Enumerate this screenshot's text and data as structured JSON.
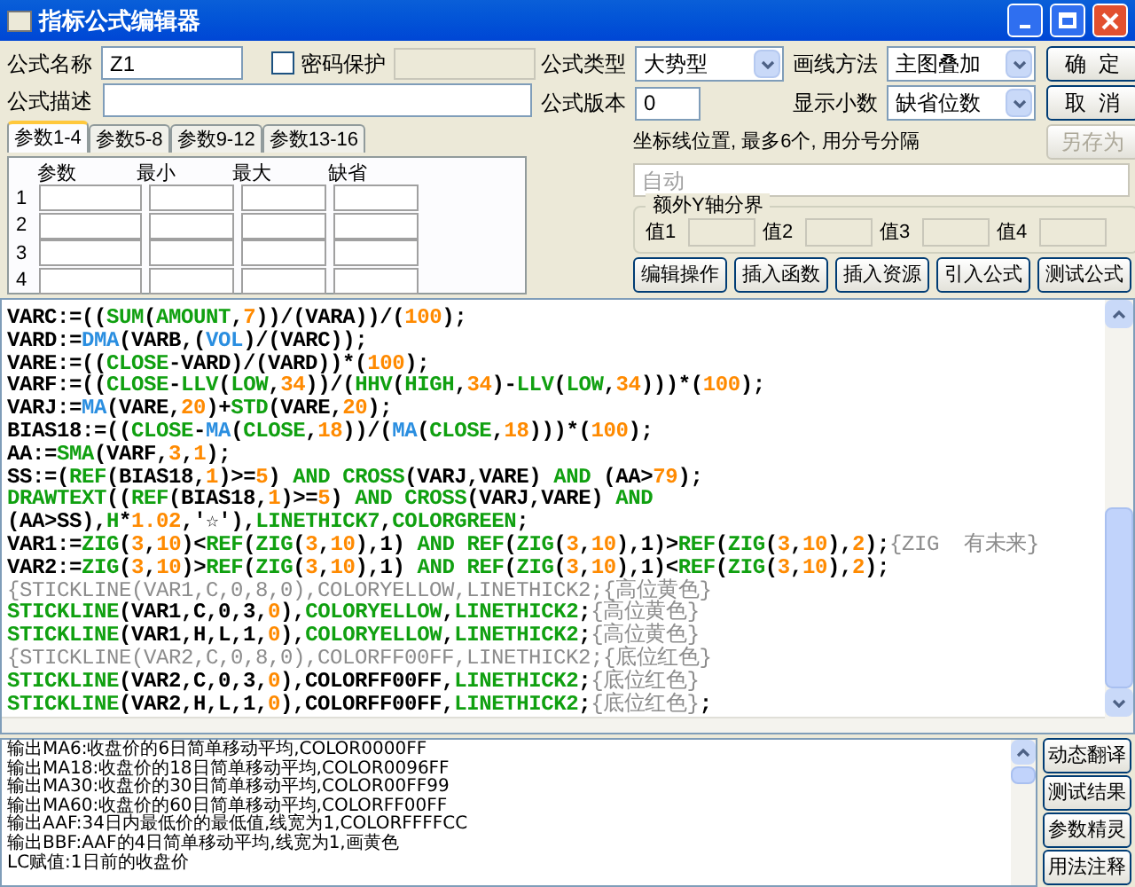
{
  "window": {
    "title": "指标公式编辑器"
  },
  "form": {
    "name_label": "公式名称",
    "name_value": "Z1",
    "password": {
      "label": "密码保护",
      "checked": false
    },
    "desc_label": "公式描述",
    "type_label": "公式类型",
    "type_value": "大势型",
    "version_label": "公式版本",
    "version_value": "0",
    "draw_label": "画线方法",
    "draw_value": "主图叠加",
    "decimals_label": "显示小数",
    "decimals_value": "缺省位数",
    "side_buttons": [
      {
        "label": "确  定",
        "disabled": false
      },
      {
        "label": "取  消",
        "disabled": false
      },
      {
        "label": "另存为",
        "disabled": true
      }
    ],
    "axis_label": "坐标线位置, 最多6个, 用分号分隔",
    "axis_placeholder": "自动",
    "extra_group": {
      "title": "额外Y轴分界",
      "values": [
        "值1",
        "值2",
        "值3",
        "值4"
      ]
    },
    "action_buttons": [
      "编辑操作",
      "插入函数",
      "插入资源",
      "引入公式",
      "测试公式"
    ]
  },
  "tabs": [
    {
      "label": "参数1-4",
      "selected": true
    },
    {
      "label": "参数5-8",
      "selected": false
    },
    {
      "label": "参数9-12",
      "selected": false
    },
    {
      "label": "参数13-16",
      "selected": false
    }
  ],
  "params": {
    "headers": [
      "参数",
      "最小",
      "最大",
      "缺省"
    ],
    "rows": [
      "1",
      "2",
      "3",
      "4"
    ]
  },
  "code": {
    "lines": [
      {
        "tokens": [
          {
            "kind": "tx",
            "text": "VARC:=(("
          },
          {
            "kind": "kw",
            "text": "SUM"
          },
          {
            "kind": "tx",
            "text": "("
          },
          {
            "kind": "kw",
            "text": "AMOUNT"
          },
          {
            "kind": "tx",
            "text": ","
          },
          {
            "kind": "num",
            "text": "7"
          },
          {
            "kind": "tx",
            "text": "))/(VARA))/("
          },
          {
            "kind": "num",
            "text": "100"
          },
          {
            "kind": "tx",
            "text": ");"
          }
        ]
      },
      {
        "tokens": [
          {
            "kind": "tx",
            "text": "VARD:="
          },
          {
            "kind": "fn",
            "text": "DMA"
          },
          {
            "kind": "tx",
            "text": "(VARB,("
          },
          {
            "kind": "fn",
            "text": "VOL"
          },
          {
            "kind": "tx",
            "text": ")/(VARC));"
          }
        ]
      },
      {
        "tokens": [
          {
            "kind": "tx",
            "text": "VARE:=(("
          },
          {
            "kind": "kw",
            "text": "CLOSE"
          },
          {
            "kind": "tx",
            "text": "-VARD)/(VARD))*("
          },
          {
            "kind": "num",
            "text": "100"
          },
          {
            "kind": "tx",
            "text": ");"
          }
        ]
      },
      {
        "tokens": [
          {
            "kind": "tx",
            "text": "VARF:=(("
          },
          {
            "kind": "kw",
            "text": "CLOSE"
          },
          {
            "kind": "tx",
            "text": "-"
          },
          {
            "kind": "kw",
            "text": "LLV"
          },
          {
            "kind": "tx",
            "text": "("
          },
          {
            "kind": "kw",
            "text": "LOW"
          },
          {
            "kind": "tx",
            "text": ","
          },
          {
            "kind": "num",
            "text": "34"
          },
          {
            "kind": "tx",
            "text": "))/("
          },
          {
            "kind": "kw",
            "text": "HHV"
          },
          {
            "kind": "tx",
            "text": "("
          },
          {
            "kind": "kw",
            "text": "HIGH"
          },
          {
            "kind": "tx",
            "text": ","
          },
          {
            "kind": "num",
            "text": "34"
          },
          {
            "kind": "tx",
            "text": ")-"
          },
          {
            "kind": "kw",
            "text": "LLV"
          },
          {
            "kind": "tx",
            "text": "("
          },
          {
            "kind": "kw",
            "text": "LOW"
          },
          {
            "kind": "tx",
            "text": ","
          },
          {
            "kind": "num",
            "text": "34"
          },
          {
            "kind": "tx",
            "text": ")))*("
          },
          {
            "kind": "num",
            "text": "100"
          },
          {
            "kind": "tx",
            "text": ");"
          }
        ]
      },
      {
        "tokens": [
          {
            "kind": "tx",
            "text": "VARJ:="
          },
          {
            "kind": "fn",
            "text": "MA"
          },
          {
            "kind": "tx",
            "text": "(VARE,"
          },
          {
            "kind": "num",
            "text": "20"
          },
          {
            "kind": "tx",
            "text": ")+"
          },
          {
            "kind": "kw",
            "text": "STD"
          },
          {
            "kind": "tx",
            "text": "(VARE,"
          },
          {
            "kind": "num",
            "text": "20"
          },
          {
            "kind": "tx",
            "text": ");"
          }
        ]
      },
      {
        "tokens": [
          {
            "kind": "tx",
            "text": "BIAS18:=(("
          },
          {
            "kind": "kw",
            "text": "CLOSE"
          },
          {
            "kind": "tx",
            "text": "-"
          },
          {
            "kind": "fn",
            "text": "MA"
          },
          {
            "kind": "tx",
            "text": "("
          },
          {
            "kind": "kw",
            "text": "CLOSE"
          },
          {
            "kind": "tx",
            "text": ","
          },
          {
            "kind": "num",
            "text": "18"
          },
          {
            "kind": "tx",
            "text": "))/("
          },
          {
            "kind": "fn",
            "text": "MA"
          },
          {
            "kind": "tx",
            "text": "("
          },
          {
            "kind": "kw",
            "text": "CLOSE"
          },
          {
            "kind": "tx",
            "text": ","
          },
          {
            "kind": "num",
            "text": "18"
          },
          {
            "kind": "tx",
            "text": ")))*("
          },
          {
            "kind": "num",
            "text": "100"
          },
          {
            "kind": "tx",
            "text": ");"
          }
        ]
      },
      {
        "tokens": [
          {
            "kind": "tx",
            "text": "AA:="
          },
          {
            "kind": "kw",
            "text": "SMA"
          },
          {
            "kind": "tx",
            "text": "(VARF,"
          },
          {
            "kind": "num",
            "text": "3"
          },
          {
            "kind": "tx",
            "text": ","
          },
          {
            "kind": "num",
            "text": "1"
          },
          {
            "kind": "tx",
            "text": ");"
          }
        ]
      },
      {
        "tokens": [
          {
            "kind": "tx",
            "text": "SS:=("
          },
          {
            "kind": "kw",
            "text": "REF"
          },
          {
            "kind": "tx",
            "text": "(BIAS18,"
          },
          {
            "kind": "num",
            "text": "1"
          },
          {
            "kind": "tx",
            "text": ")>="
          },
          {
            "kind": "num",
            "text": "5"
          },
          {
            "kind": "tx",
            "text": ") "
          },
          {
            "kind": "kw",
            "text": "AND CROSS"
          },
          {
            "kind": "tx",
            "text": "(VARJ,VARE) "
          },
          {
            "kind": "kw",
            "text": "AND"
          },
          {
            "kind": "tx",
            "text": " (AA>"
          },
          {
            "kind": "num",
            "text": "79"
          },
          {
            "kind": "tx",
            "text": ");"
          }
        ]
      },
      {
        "tokens": [
          {
            "kind": "kw",
            "text": "DRAWTEXT"
          },
          {
            "kind": "tx",
            "text": "(("
          },
          {
            "kind": "kw",
            "text": "REF"
          },
          {
            "kind": "tx",
            "text": "(BIAS18,"
          },
          {
            "kind": "num",
            "text": "1"
          },
          {
            "kind": "tx",
            "text": ")>="
          },
          {
            "kind": "num",
            "text": "5"
          },
          {
            "kind": "tx",
            "text": ") "
          },
          {
            "kind": "kw",
            "text": "AND CROSS"
          },
          {
            "kind": "tx",
            "text": "(VARJ,VARE) "
          },
          {
            "kind": "kw",
            "text": "AND"
          }
        ]
      },
      {
        "tokens": [
          {
            "kind": "tx",
            "text": "(AA>SS),"
          },
          {
            "kind": "kw",
            "text": "H"
          },
          {
            "kind": "tx",
            "text": "*"
          },
          {
            "kind": "num",
            "text": "1.02"
          },
          {
            "kind": "tx",
            "text": ",'☆'),"
          },
          {
            "kind": "kw",
            "text": "LINETHICK7"
          },
          {
            "kind": "tx",
            "text": ","
          },
          {
            "kind": "kw",
            "text": "COLORGREEN"
          },
          {
            "kind": "tx",
            "text": ";"
          }
        ]
      },
      {
        "tokens": [
          {
            "kind": "tx",
            "text": "VAR1:="
          },
          {
            "kind": "kw",
            "text": "ZIG"
          },
          {
            "kind": "tx",
            "text": "("
          },
          {
            "kind": "num",
            "text": "3"
          },
          {
            "kind": "tx",
            "text": ","
          },
          {
            "kind": "num",
            "text": "10"
          },
          {
            "kind": "tx",
            "text": ")<"
          },
          {
            "kind": "kw",
            "text": "REF"
          },
          {
            "kind": "tx",
            "text": "("
          },
          {
            "kind": "kw",
            "text": "ZIG"
          },
          {
            "kind": "tx",
            "text": "("
          },
          {
            "kind": "num",
            "text": "3"
          },
          {
            "kind": "tx",
            "text": ","
          },
          {
            "kind": "num",
            "text": "10"
          },
          {
            "kind": "tx",
            "text": "),1) "
          },
          {
            "kind": "kw",
            "text": "AND REF"
          },
          {
            "kind": "tx",
            "text": "("
          },
          {
            "kind": "kw",
            "text": "ZIG"
          },
          {
            "kind": "tx",
            "text": "("
          },
          {
            "kind": "num",
            "text": "3"
          },
          {
            "kind": "tx",
            "text": ","
          },
          {
            "kind": "num",
            "text": "10"
          },
          {
            "kind": "tx",
            "text": "),1)>"
          },
          {
            "kind": "kw",
            "text": "REF"
          },
          {
            "kind": "tx",
            "text": "("
          },
          {
            "kind": "kw",
            "text": "ZIG"
          },
          {
            "kind": "tx",
            "text": "("
          },
          {
            "kind": "num",
            "text": "3"
          },
          {
            "kind": "tx",
            "text": ","
          },
          {
            "kind": "num",
            "text": "10"
          },
          {
            "kind": "tx",
            "text": "),"
          },
          {
            "kind": "num",
            "text": "2"
          },
          {
            "kind": "tx",
            "text": ");"
          },
          {
            "kind": "cm",
            "text": "{ZIG  有未来}"
          }
        ]
      },
      {
        "tokens": [
          {
            "kind": "tx",
            "text": "VAR2:="
          },
          {
            "kind": "kw",
            "text": "ZIG"
          },
          {
            "kind": "tx",
            "text": "("
          },
          {
            "kind": "num",
            "text": "3"
          },
          {
            "kind": "tx",
            "text": ","
          },
          {
            "kind": "num",
            "text": "10"
          },
          {
            "kind": "tx",
            "text": ")>"
          },
          {
            "kind": "kw",
            "text": "REF"
          },
          {
            "kind": "tx",
            "text": "("
          },
          {
            "kind": "kw",
            "text": "ZIG"
          },
          {
            "kind": "tx",
            "text": "("
          },
          {
            "kind": "num",
            "text": "3"
          },
          {
            "kind": "tx",
            "text": ","
          },
          {
            "kind": "num",
            "text": "10"
          },
          {
            "kind": "tx",
            "text": "),1) "
          },
          {
            "kind": "kw",
            "text": "AND REF"
          },
          {
            "kind": "tx",
            "text": "("
          },
          {
            "kind": "kw",
            "text": "ZIG"
          },
          {
            "kind": "tx",
            "text": "("
          },
          {
            "kind": "num",
            "text": "3"
          },
          {
            "kind": "tx",
            "text": ","
          },
          {
            "kind": "num",
            "text": "10"
          },
          {
            "kind": "tx",
            "text": "),1)<"
          },
          {
            "kind": "kw",
            "text": "REF"
          },
          {
            "kind": "tx",
            "text": "("
          },
          {
            "kind": "kw",
            "text": "ZIG"
          },
          {
            "kind": "tx",
            "text": "("
          },
          {
            "kind": "num",
            "text": "3"
          },
          {
            "kind": "tx",
            "text": ","
          },
          {
            "kind": "num",
            "text": "10"
          },
          {
            "kind": "tx",
            "text": "),"
          },
          {
            "kind": "num",
            "text": "2"
          },
          {
            "kind": "tx",
            "text": ");"
          }
        ]
      },
      {
        "tokens": [
          {
            "kind": "cm",
            "text": "{STICKLINE(VAR1,C,0,8,0),COLORYELLOW,LINETHICK2;{高位黄色}"
          }
        ]
      },
      {
        "tokens": [
          {
            "kind": "kw",
            "text": "STICKLINE"
          },
          {
            "kind": "tx",
            "text": "(VAR1,C,0,3,"
          },
          {
            "kind": "num",
            "text": "0"
          },
          {
            "kind": "tx",
            "text": "),"
          },
          {
            "kind": "kw",
            "text": "COLORYELLOW"
          },
          {
            "kind": "tx",
            "text": ","
          },
          {
            "kind": "kw",
            "text": "LINETHICK2"
          },
          {
            "kind": "tx",
            "text": ";"
          },
          {
            "kind": "cm",
            "text": "{高位黄色}"
          }
        ]
      },
      {
        "tokens": [
          {
            "kind": "kw",
            "text": "STICKLINE"
          },
          {
            "kind": "tx",
            "text": "(VAR1,H,L,1,"
          },
          {
            "kind": "num",
            "text": "0"
          },
          {
            "kind": "tx",
            "text": "),"
          },
          {
            "kind": "kw",
            "text": "COLORYELLOW"
          },
          {
            "kind": "tx",
            "text": ","
          },
          {
            "kind": "kw",
            "text": "LINETHICK2"
          },
          {
            "kind": "tx",
            "text": ";"
          },
          {
            "kind": "cm",
            "text": "{高位黄色}"
          }
        ]
      },
      {
        "tokens": [
          {
            "kind": "cm",
            "text": "{STICKLINE(VAR2,C,0,8,0),COLORFF00FF,LINETHICK2;{底位红色}"
          }
        ]
      },
      {
        "tokens": [
          {
            "kind": "kw",
            "text": "STICKLINE"
          },
          {
            "kind": "tx",
            "text": "(VAR2,C,0,3,"
          },
          {
            "kind": "num",
            "text": "0"
          },
          {
            "kind": "tx",
            "text": "),COLORFF00FF,"
          },
          {
            "kind": "kw",
            "text": "LINETHICK2"
          },
          {
            "kind": "tx",
            "text": ";"
          },
          {
            "kind": "cm",
            "text": "{底位红色}"
          }
        ]
      },
      {
        "tokens": [
          {
            "kind": "kw",
            "text": "STICKLINE"
          },
          {
            "kind": "tx",
            "text": "(VAR2,H,L,1,"
          },
          {
            "kind": "num",
            "text": "0"
          },
          {
            "kind": "tx",
            "text": "),COLORFF00FF,"
          },
          {
            "kind": "kw",
            "text": "LINETHICK2"
          },
          {
            "kind": "tx",
            "text": ";"
          },
          {
            "kind": "cm",
            "text": "{底位红色}"
          },
          {
            "kind": "tx",
            "text": ";"
          }
        ]
      }
    ]
  },
  "output": {
    "lines": [
      "输出MA6:收盘价的6日简单移动平均,COLOR0000FF",
      "输出MA18:收盘价的18日简单移动平均,COLOR0096FF",
      "输出MA30:收盘价的30日简单移动平均,COLOR00FF99",
      "输出MA60:收盘价的60日简单移动平均,COLORFF00FF",
      "输出AAF:34日内最低价的最低值,线宽为1,COLORFFFFCC",
      "输出BBF:AAF的4日简单移动平均,线宽为1,画黄色",
      "LC赋值:1日前的收盘价"
    ],
    "buttons": [
      "动态翻译",
      "测试结果",
      "参数精灵",
      "用法注释"
    ]
  }
}
